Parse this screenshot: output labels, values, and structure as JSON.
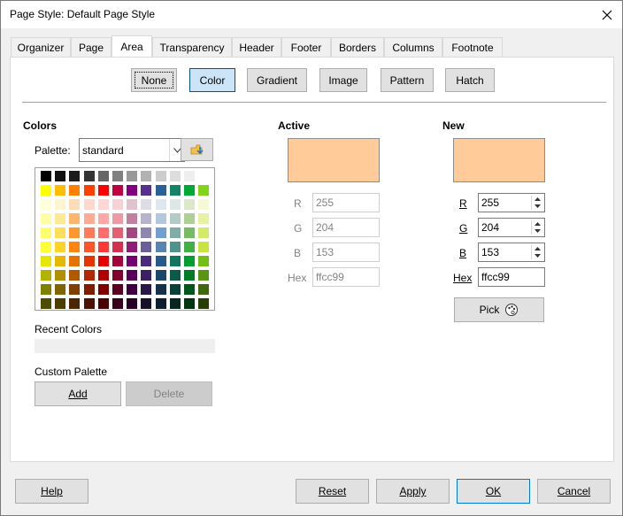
{
  "window": {
    "title": "Page Style: Default Page Style"
  },
  "tabs": [
    {
      "label": "Organizer",
      "active": false
    },
    {
      "label": "Page",
      "active": false
    },
    {
      "label": "Area",
      "active": true
    },
    {
      "label": "Transparency",
      "active": false
    },
    {
      "label": "Header",
      "active": false
    },
    {
      "label": "Footer",
      "active": false
    },
    {
      "label": "Borders",
      "active": false
    },
    {
      "label": "Columns",
      "active": false
    },
    {
      "label": "Footnote",
      "active": false
    }
  ],
  "fill_types": [
    {
      "label": "None",
      "selected": false
    },
    {
      "label": "Color",
      "selected": true
    },
    {
      "label": "Gradient",
      "selected": false
    },
    {
      "label": "Image",
      "selected": false
    },
    {
      "label": "Pattern",
      "selected": false
    },
    {
      "label": "Hatch",
      "selected": false
    }
  ],
  "colors": {
    "heading": "Colors",
    "palette_label": "Palette:",
    "palette_value": "standard",
    "recent_label": "Recent Colors",
    "custom_label": "Custom Palette",
    "add_label": "Add",
    "delete_label": "Delete",
    "grid": [
      [
        "#000000",
        "#111111",
        "#1c1c1c",
        "#333333",
        "#666666",
        "#808080",
        "#999999",
        "#b2b2b2",
        "#cccccc",
        "#dddddd",
        "#eeeeee",
        "#ffffff"
      ],
      [
        "#ffff00",
        "#ffbf00",
        "#ff8000",
        "#ff4000",
        "#ff0000",
        "#bf0041",
        "#800080",
        "#55308d",
        "#2a6099",
        "#158466",
        "#00a933",
        "#81d41a"
      ],
      [
        "#ffffd7",
        "#fff5ce",
        "#ffdbb6",
        "#ffd8ce",
        "#ffd7d7",
        "#f7d1d5",
        "#e0c2cd",
        "#dedce6",
        "#dee6ef",
        "#dee7e5",
        "#dde8cb",
        "#f6f9d4"
      ],
      [
        "#ffffa6",
        "#ffe994",
        "#ffb66c",
        "#ffaa95",
        "#ffa6a6",
        "#ec9ba4",
        "#bf819e",
        "#b7b3ca",
        "#b4c7dc",
        "#b3cac7",
        "#afd095",
        "#e8f2a1"
      ],
      [
        "#ffff6d",
        "#ffde59",
        "#ff972f",
        "#ff7b59",
        "#ff6d6d",
        "#e16173",
        "#a1467e",
        "#8e86ae",
        "#729fcf",
        "#81aca6",
        "#77bc65",
        "#d4ea6b"
      ],
      [
        "#ffff38",
        "#ffd428",
        "#ff860d",
        "#ff5429",
        "#ff3838",
        "#d62e4e",
        "#8d1d75",
        "#6b5e9b",
        "#5983b0",
        "#50938a",
        "#3faf46",
        "#c9e440"
      ],
      [
        "#e6e600",
        "#e6b800",
        "#e67300",
        "#e63300",
        "#e60000",
        "#a4003a",
        "#730073",
        "#4c2b7f",
        "#265a8a",
        "#137460",
        "#009e30",
        "#74bf17"
      ],
      [
        "#b2b200",
        "#b28f00",
        "#b25900",
        "#b22800",
        "#b20000",
        "#7f002d",
        "#590059",
        "#3b2163",
        "#1e466b",
        "#0e5a4a",
        "#007a25",
        "#5a9412"
      ],
      [
        "#808000",
        "#806600",
        "#804000",
        "#801d00",
        "#800000",
        "#5b0020",
        "#400040",
        "#2a1847",
        "#15324d",
        "#0a4035",
        "#00581b",
        "#40690d"
      ],
      [
        "#4d4d00",
        "#4d3d00",
        "#4d2600",
        "#4d1100",
        "#4d0000",
        "#37001b",
        "#260026",
        "#19102a",
        "#0d1e2e",
        "#062620",
        "#003510",
        "#263f08"
      ]
    ]
  },
  "active": {
    "heading": "Active",
    "color": "#ffcc99",
    "r_label": "R",
    "r": "255",
    "g_label": "G",
    "g": "204",
    "b_label": "B",
    "b": "153",
    "hex_label": "Hex",
    "hex": "ffcc99"
  },
  "new": {
    "heading": "New",
    "color": "#ffcc99",
    "r_label": "R",
    "r": "255",
    "g_label": "G",
    "g": "204",
    "b_label": "B",
    "b": "153",
    "hex_label": "Hex",
    "hex": "ffcc99",
    "pick_label": "Pick"
  },
  "footer": {
    "help": "Help",
    "reset": "Reset",
    "apply": "Apply",
    "ok": "OK",
    "cancel": "Cancel"
  }
}
